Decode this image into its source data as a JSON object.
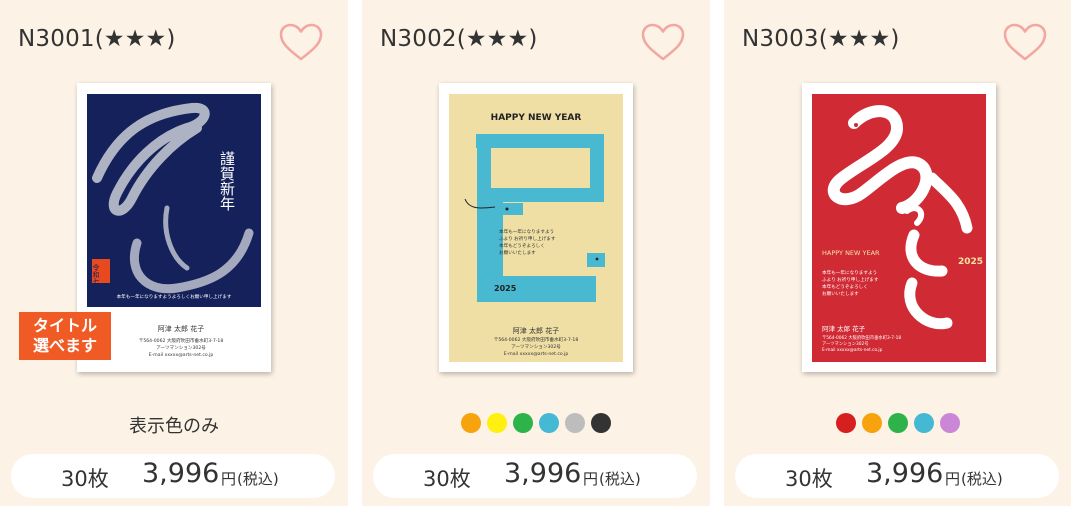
{
  "products": [
    {
      "code": "N3001(★★★)",
      "card_text": {
        "greeting": "謹賀新年",
        "stamp": "令和七年",
        "message": "本年も一年になりますようよろしくお願い申し上げます",
        "sender": "阿津 太郎  花子",
        "address": "〒564-0062 大阪府吹田市垂水町3-7-18",
        "building": "アーツマンション302号",
        "email": "E-mail   xxxxx@arts-net.co.jp"
      },
      "tag": [
        "タイトル",
        "選べます"
      ],
      "color_note": "表示色のみ",
      "price": {
        "qty": "30枚",
        "amount": "3,996",
        "yen": "円",
        "tax": "(税込)"
      }
    },
    {
      "code": "N3002(★★★)",
      "card_text": {
        "headline": "HAPPY NEW YEAR",
        "year": "2025",
        "message_lines": [
          "本年も一年になりますよう",
          "ふより お祈り申し上げます",
          "本年もどうぞよろしく",
          "お願いいたします"
        ],
        "sender": "阿津 太郎  花子",
        "address": "〒564-0062 大阪府吹田市垂水町3-7-18",
        "building": "アーツマンション302号",
        "email": "E-mail   xxxxx@arts-net.co.jp"
      },
      "swatches": [
        "#f7a30e",
        "#fff012",
        "#2db34a",
        "#45b8d4",
        "#bdbdbd",
        "#333333"
      ],
      "price": {
        "qty": "30枚",
        "amount": "3,996",
        "yen": "円",
        "tax": "(税込)"
      }
    },
    {
      "code": "N3003(★★★)",
      "card_text": {
        "title_mark": "みのとし",
        "headline": "HAPPY NEW YEAR",
        "year": "2025",
        "message_lines": [
          "本年も一年になりますよう",
          "ふより お祈り申し上げます",
          "本年もどうぞよろしく",
          "お願いいたします"
        ],
        "sender": "阿津 太郎  花子",
        "address": "〒564-0062 大阪府吹田市垂水町3-7-18",
        "building": "アーツマンション302号",
        "email": "E-mail   xxxxx@arts-net.co.jp"
      },
      "swatches": [
        "#d61f1f",
        "#f7a30e",
        "#2db34a",
        "#45b8d4",
        "#c987d6"
      ],
      "price": {
        "qty": "30枚",
        "amount": "3,996",
        "yen": "円",
        "tax": "(税込)"
      }
    }
  ],
  "icons": {
    "favorite": "heart-outline-icon"
  },
  "colors": {
    "card_bg": "#fcf3e6",
    "heart": "#f2a7a3",
    "tag": "#f05a24"
  }
}
